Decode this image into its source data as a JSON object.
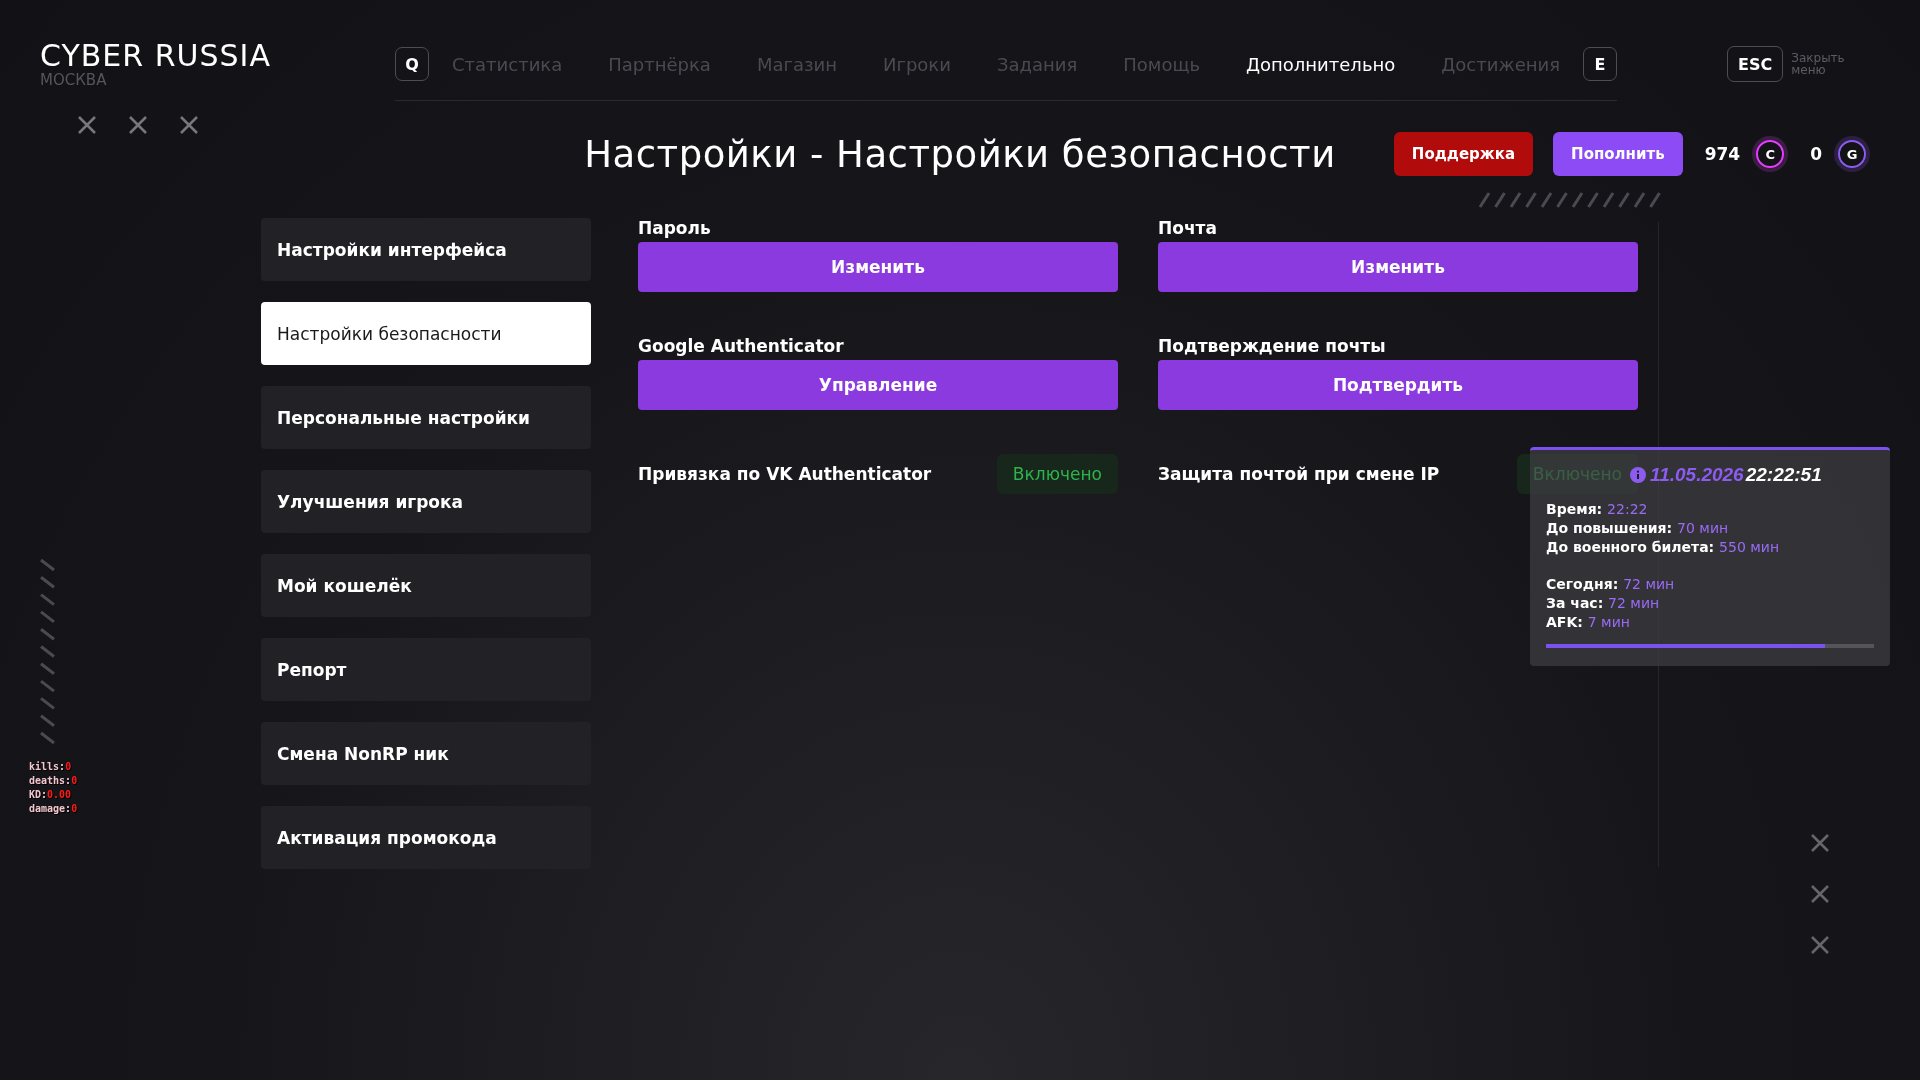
{
  "header": {
    "logo": "CYBER RUSSIA",
    "city": "МОСКВА",
    "prev_key": "Q",
    "next_key": "E",
    "close_key": "ESC",
    "close_label": "Закрыть меню",
    "nav": [
      {
        "label": "Статистика",
        "selected": false
      },
      {
        "label": "Партнёрка",
        "selected": false
      },
      {
        "label": "Магазин",
        "selected": false
      },
      {
        "label": "Игроки",
        "selected": false
      },
      {
        "label": "Задания",
        "selected": false
      },
      {
        "label": "Помощь",
        "selected": false
      },
      {
        "label": "Дополнительно",
        "selected": true
      },
      {
        "label": "Достижения",
        "selected": false
      }
    ]
  },
  "page_title": "Настройки - Настройки безопасности",
  "actions": {
    "support": "Поддержка",
    "topup": "Пополнить"
  },
  "balances": [
    {
      "amount": "974",
      "currency": "C",
      "color": "#e040fb"
    },
    {
      "amount": "0",
      "currency": "G",
      "color": "#8c5cf0"
    }
  ],
  "sidebar": [
    {
      "label": "Настройки интерфейса",
      "selected": false
    },
    {
      "label": "Настройки безопасности",
      "selected": true
    },
    {
      "label": "Персональные настройки",
      "selected": false
    },
    {
      "label": "Улучшения игрока",
      "selected": false
    },
    {
      "label": "Мой кошелёк",
      "selected": false
    },
    {
      "label": "Репорт",
      "selected": false
    },
    {
      "label": "Смена NonRP ник",
      "selected": false
    },
    {
      "label": "Активация промокода",
      "selected": false
    }
  ],
  "settings": [
    {
      "kind": "button",
      "label": "Пароль",
      "action": "Изменить"
    },
    {
      "kind": "button",
      "label": "Почта",
      "action": "Изменить"
    },
    {
      "kind": "button",
      "label": "Google Authenticator",
      "action": "Управление"
    },
    {
      "kind": "button",
      "label": "Подтверждение почты",
      "action": "Подтвердить"
    },
    {
      "kind": "toggle",
      "label": "Привязка по VK Authenticator",
      "status": "Включено",
      "on": true
    },
    {
      "kind": "toggle",
      "label": "Защита почтой при смене IP",
      "status": "Включено",
      "on": true
    }
  ],
  "stats_overlay": [
    {
      "label": "kills:",
      "value": "0"
    },
    {
      "label": "deaths:",
      "value": "0"
    },
    {
      "label": "KD:",
      "value": "0.00"
    },
    {
      "label": "damage:",
      "value": "0"
    }
  ],
  "session_panel": {
    "date": "11.05.2026",
    "time": "22:22:51",
    "level": 0.85,
    "groups": [
      [
        {
          "label": "Время:",
          "value": "22:22"
        },
        {
          "label": "До повышения:",
          "value": "70 мин"
        },
        {
          "label": "До военного билета:",
          "value": "550 мин"
        }
      ],
      [
        {
          "label": "Сегодня:",
          "value": "72 мин"
        },
        {
          "label": "За час:",
          "value": "72 мин"
        },
        {
          "label": "AFK:",
          "value": "7 мин"
        }
      ]
    ]
  }
}
